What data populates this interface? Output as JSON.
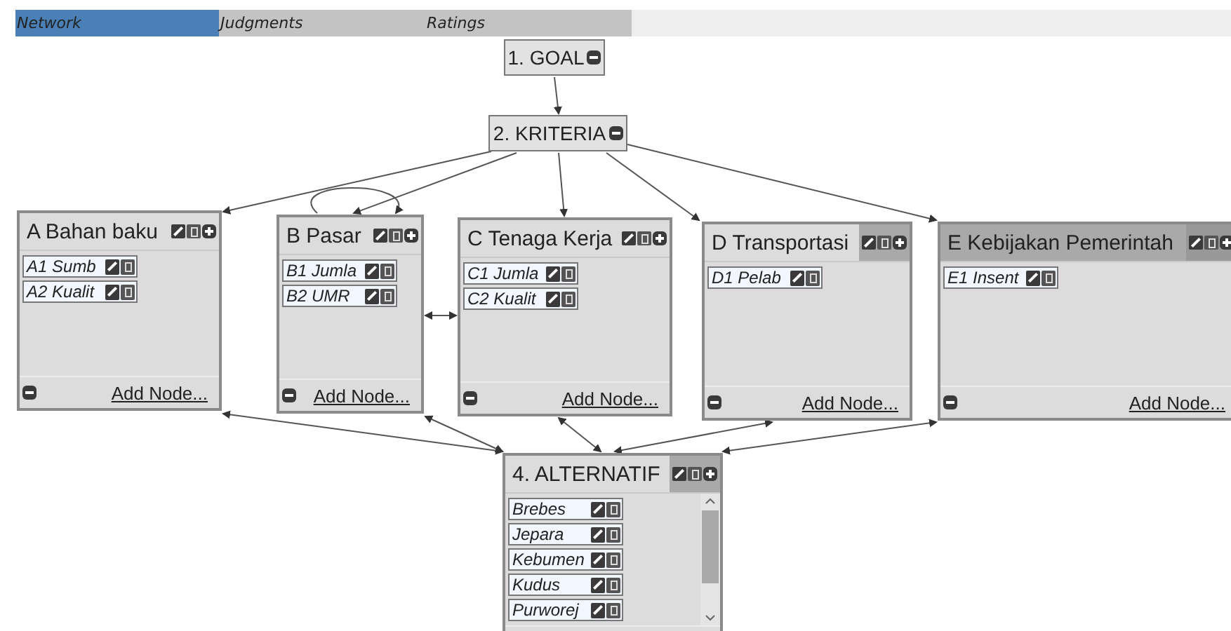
{
  "tabs": [
    {
      "label": "Network",
      "selected": true
    },
    {
      "label": "Judgments",
      "selected": false
    },
    {
      "label": "Ratings",
      "selected": false
    }
  ],
  "top_nodes": [
    {
      "label": "1. GOAL"
    },
    {
      "label": "2. KRITERIA"
    }
  ],
  "clusters": [
    {
      "title": "A Bahan baku",
      "header_shaded": false,
      "icons_shaded": false,
      "nodes": [
        "A1 Sumb",
        "A2 Kualit"
      ],
      "footer_link": "Add Node..."
    },
    {
      "title": "B Pasar",
      "header_shaded": false,
      "icons_shaded": false,
      "nodes": [
        "B1 Jumla",
        "B2 UMR"
      ],
      "footer_link": "Add Node..."
    },
    {
      "title": "C Tenaga Kerja",
      "header_shaded": false,
      "icons_shaded": false,
      "nodes": [
        "C1 Jumla",
        "C2 Kualit"
      ],
      "footer_link": "Add Node..."
    },
    {
      "title": "D Transportasi",
      "header_shaded": false,
      "icons_shaded": true,
      "nodes": [
        "D1 Pelab"
      ],
      "footer_link": "Add Node..."
    },
    {
      "title": "E Kebijakan Pemerintah",
      "header_shaded": true,
      "icons_shaded": true,
      "nodes": [
        "E1 Insent"
      ],
      "footer_link": "Add Node..."
    }
  ],
  "alternatives_cluster": {
    "title": "4. ALTERNATIF",
    "header_shaded": false,
    "icons_shaded": true,
    "nodes": [
      "Brebes",
      "Jepara",
      "Kebumen",
      "Kudus",
      "Purworej"
    ]
  }
}
